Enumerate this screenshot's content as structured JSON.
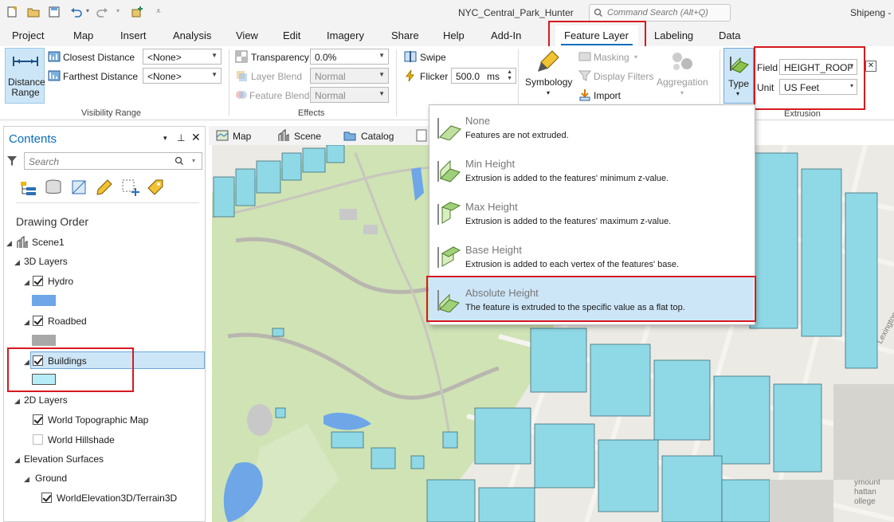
{
  "titlebar": {
    "doc_title": "NYC_Central_Park_Hunter",
    "command_search_placeholder": "Command Search (Alt+Q)",
    "user": "Shipeng - "
  },
  "tabs": [
    "Project",
    "Map",
    "Insert",
    "Analysis",
    "View",
    "Edit",
    "Imagery",
    "Share",
    "Help",
    "Add-In",
    "Feature Layer",
    "Labeling",
    "Data"
  ],
  "ribbon": {
    "visibility_range": {
      "distance_range_label": "Distance Range",
      "closest_label": "Closest Distance",
      "closest_value": "<None>",
      "farthest_label": "Farthest Distance",
      "farthest_value": "<None>",
      "group_label": "Visibility Range"
    },
    "effects": {
      "transparency_label": "Transparency",
      "transparency_value": "0.0%",
      "layer_blend_label": "Layer Blend",
      "layer_blend_value": "Normal",
      "feature_blend_label": "Feature Blend",
      "feature_blend_value": "Normal",
      "swipe_label": "Swipe",
      "flicker_label": "Flicker",
      "flicker_value": "500.0",
      "flicker_unit": "ms",
      "group_label": "Effects"
    },
    "drawing": {
      "symbology_label": "Symbology",
      "masking_label": "Masking",
      "display_filters_label": "Display Filters",
      "import_label": "Import",
      "aggregation_label": "Aggregation"
    },
    "extrusion": {
      "type_label": "Type",
      "field_label": "Field",
      "field_value": "HEIGHT_ROOF",
      "unit_label": "Unit",
      "unit_value": "US Feet",
      "group_label": "Extrusion"
    }
  },
  "contents": {
    "title": "Contents",
    "search_placeholder": "Search",
    "drawing_order_label": "Drawing Order",
    "scene": "Scene1",
    "group_3d": "3D Layers",
    "layers_3d": [
      "Hydro",
      "Roadbed",
      "Buildings"
    ],
    "group_2d": "2D Layers",
    "layers_2d": [
      "World Topographic Map",
      "World Hillshade"
    ],
    "group_elev": "Elevation Surfaces",
    "ground": "Ground",
    "terrain": "WorldElevation3D/Terrain3D"
  },
  "view_tabs": [
    "Map",
    "Scene",
    "Catalog"
  ],
  "map_labels": {
    "street": "Lexington Ave",
    "college": "ymount\nhattan\nollege"
  },
  "extrusion_menu": [
    {
      "title": "None",
      "desc": "Features are not extruded."
    },
    {
      "title": "Min Height",
      "desc": "Extrusion is added to the features' minimum z-value."
    },
    {
      "title": "Max Height",
      "desc": "Extrusion is added to the features' maximum z-value."
    },
    {
      "title": "Base Height",
      "desc": "Extrusion is added to each vertex of the features' base."
    },
    {
      "title": "Absolute Height",
      "desc": "The feature is extruded to the specific value as a flat top."
    }
  ],
  "colors": {
    "accent": "#0a6ebd",
    "highlight_red": "#d71920",
    "building_fill": "#8fd8e6",
    "water": "#6ea6e8",
    "park": "#cfe3b5",
    "selection": "#cde6f7"
  }
}
